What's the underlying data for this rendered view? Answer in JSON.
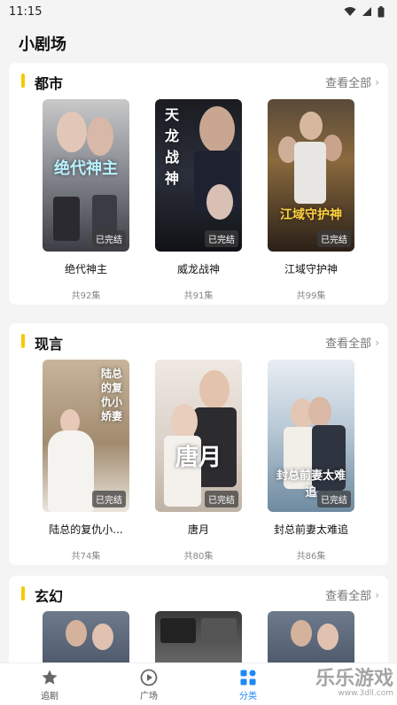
{
  "status": {
    "time": "11:15"
  },
  "page_title": "小剧场",
  "categories": [
    {
      "title": "都市",
      "see_all": "查看全部",
      "items": [
        {
          "title": "绝代神主",
          "episodes": "共92集",
          "badge": "已完结",
          "art": "绝代神主"
        },
        {
          "title": "威龙战神",
          "episodes": "共91集",
          "badge": "已完结",
          "art": "天龙战神"
        },
        {
          "title": "江域守护神",
          "episodes": "共99集",
          "badge": "已完结",
          "art": "江域守护神"
        }
      ]
    },
    {
      "title": "现言",
      "see_all": "查看全部",
      "items": [
        {
          "title": "陆总的复仇小...",
          "episodes": "共74集",
          "badge": "已完结",
          "art": "陆总的复仇小娇妻"
        },
        {
          "title": "唐月",
          "episodes": "共80集",
          "badge": "已完结",
          "art": "唐月"
        },
        {
          "title": "封总前妻太难追",
          "episodes": "共86集",
          "badge": "已完结",
          "art": "封总前妻太难追"
        }
      ]
    },
    {
      "title": "玄幻",
      "see_all": "查看全部",
      "items": []
    }
  ],
  "tabs": [
    {
      "label": "追剧",
      "icon": "star-icon"
    },
    {
      "label": "广场",
      "icon": "play-icon"
    },
    {
      "label": "分类",
      "icon": "grid-icon"
    }
  ],
  "watermark": {
    "text": "乐乐游戏",
    "sub": "www.3dll.com"
  },
  "colors": {
    "accent": "#f7c900",
    "active_tab": "#1e88f5"
  }
}
